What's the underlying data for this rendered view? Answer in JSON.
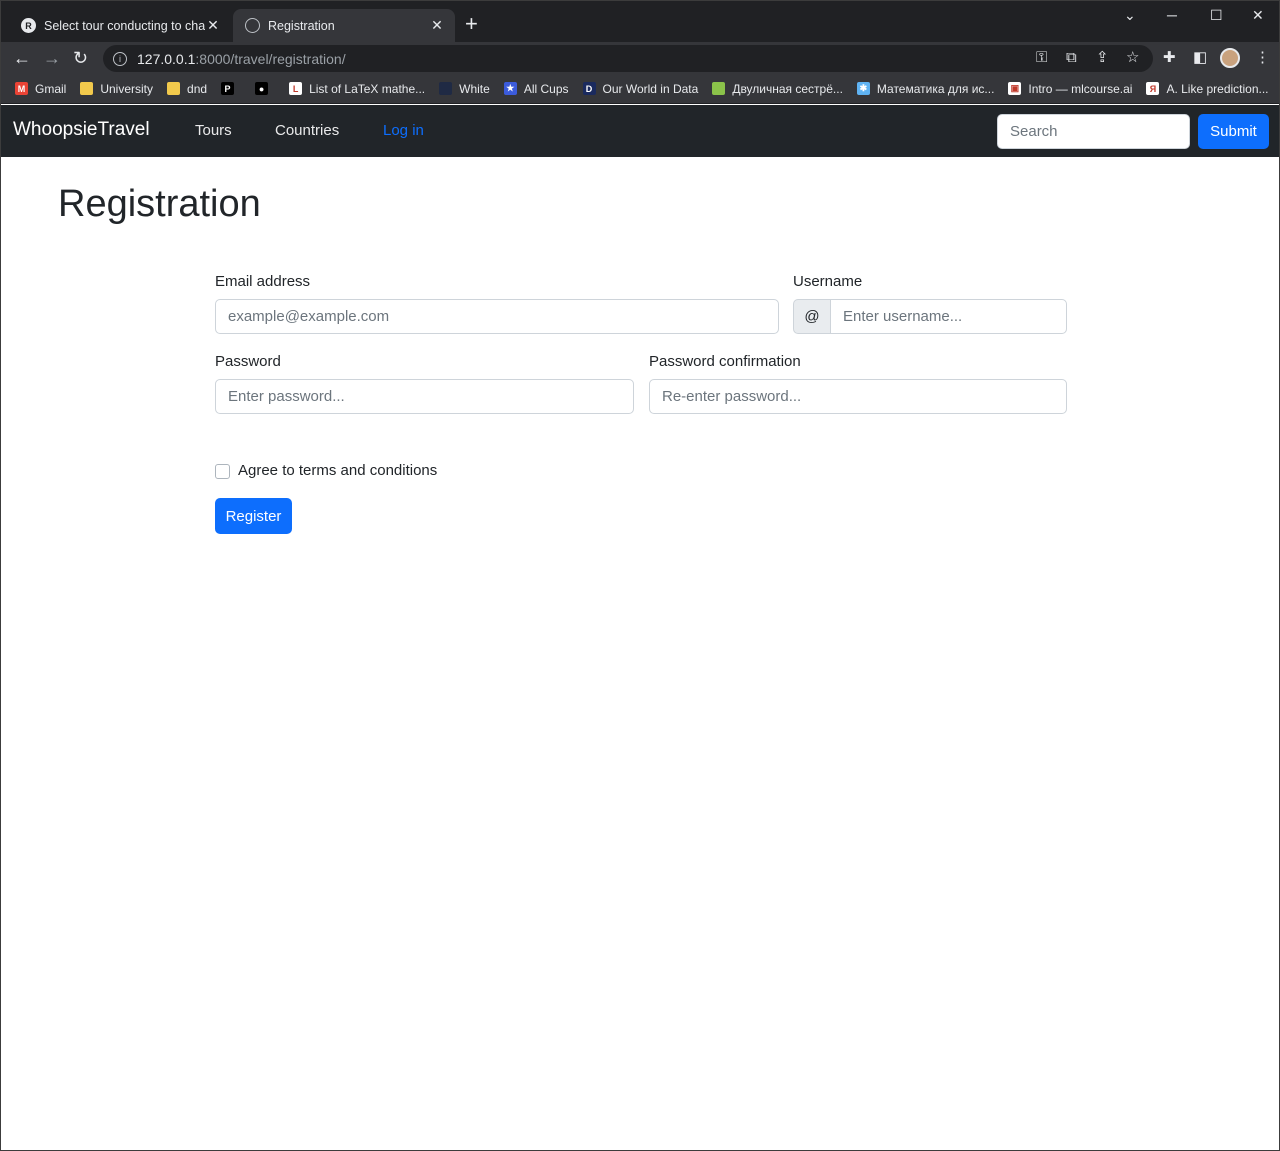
{
  "browser": {
    "tabs": [
      {
        "title": "Select tour conducting to change",
        "favicon": "R",
        "active": false
      },
      {
        "title": "Registration",
        "favicon": "",
        "active": true
      }
    ],
    "url_host": "127.0.0.1",
    "url_path": ":8000/travel/registration/",
    "bookmarks": [
      {
        "label": "Gmail",
        "icon": "gmail-icon",
        "color": "#ea4335",
        "glyph": "M"
      },
      {
        "label": "University",
        "icon": "folder-icon",
        "color": "#f2c94c",
        "glyph": ""
      },
      {
        "label": "dnd",
        "icon": "folder-icon",
        "color": "#f2c94c",
        "glyph": ""
      },
      {
        "label": "",
        "icon": "p-logo-icon",
        "color": "#000000",
        "glyph": "P"
      },
      {
        "label": "",
        "icon": "github-icon",
        "color": "#000000",
        "glyph": "●"
      },
      {
        "label": "List of LaTeX mathe...",
        "icon": "latex-icon",
        "color": "#ffffff",
        "glyph": "L"
      },
      {
        "label": "White",
        "icon": "dark-square-icon",
        "color": "#1f2a44",
        "glyph": ""
      },
      {
        "label": "All Cups",
        "icon": "cup-icon",
        "color": "#3b5bdb",
        "glyph": "★"
      },
      {
        "label": "Our World in Data",
        "icon": "owid-icon",
        "color": "#1a2a5e",
        "glyph": "D"
      },
      {
        "label": "Двуличная сестрё...",
        "icon": "globe-icon",
        "color": "#8bc34a",
        "glyph": ""
      },
      {
        "label": "Математика для ис...",
        "icon": "math-icon",
        "color": "#5fb3f3",
        "glyph": "✱"
      },
      {
        "label": "Intro — mlcourse.ai",
        "icon": "mlcourse-icon",
        "color": "#ffffff",
        "glyph": "▣"
      },
      {
        "label": "A. Like prediction...",
        "icon": "yandex-icon",
        "color": "#ffffff",
        "glyph": "Я"
      }
    ]
  },
  "navbar": {
    "brand": "WhoopsieTravel",
    "links": [
      "Tours",
      "Countries",
      "Log in"
    ],
    "search_placeholder": "Search",
    "submit_label": "Submit"
  },
  "page": {
    "title": "Registration",
    "email_label": "Email address",
    "email_placeholder": "example@example.com",
    "username_label": "Username",
    "username_addon": "@",
    "username_placeholder": "Enter username...",
    "password_label": "Password",
    "password_placeholder": "Enter password...",
    "confirm_label": "Password confirmation",
    "confirm_placeholder": "Re-enter password...",
    "terms_label": "Agree to terms and conditions",
    "terms_checked": false,
    "register_label": "Register"
  },
  "colors": {
    "primary": "#0d6efd",
    "navbar_bg": "#212529"
  }
}
